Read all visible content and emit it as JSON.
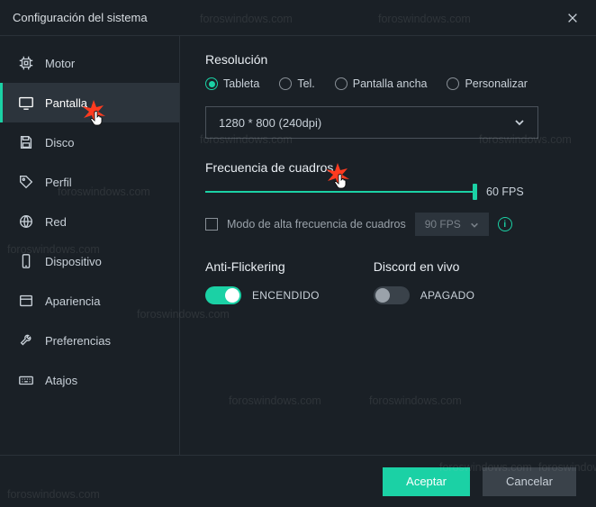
{
  "window": {
    "title": "Configuración del sistema"
  },
  "sidebar": {
    "items": [
      {
        "label": "Motor",
        "icon": "cpu-icon"
      },
      {
        "label": "Pantalla",
        "icon": "display-icon"
      },
      {
        "label": "Disco",
        "icon": "save-icon"
      },
      {
        "label": "Perfil",
        "icon": "tag-icon"
      },
      {
        "label": "Red",
        "icon": "globe-icon"
      },
      {
        "label": "Dispositivo",
        "icon": "phone-icon"
      },
      {
        "label": "Apariencia",
        "icon": "window-icon"
      },
      {
        "label": "Preferencias",
        "icon": "tool-icon"
      },
      {
        "label": "Atajos",
        "icon": "keyboard-icon"
      }
    ],
    "active_index": 1
  },
  "resolution": {
    "title": "Resolución",
    "options": [
      "Tableta",
      "Tel.",
      "Pantalla ancha",
      "Personalizar"
    ],
    "selected_index": 0,
    "dropdown_value": "1280 * 800 (240dpi)"
  },
  "framerate": {
    "title": "Frecuencia de cuadros",
    "value_label": "60 FPS",
    "high_fps_checkbox_label": "Modo de alta frecuencia de cuadros",
    "high_fps_checked": false,
    "high_fps_dropdown": "90 FPS"
  },
  "anti_flicker": {
    "title": "Anti-Flickering",
    "on": true,
    "state_label": "ENCENDIDO"
  },
  "discord": {
    "title": "Discord en vivo",
    "on": false,
    "state_label": "APAGADO"
  },
  "footer": {
    "accept": "Aceptar",
    "cancel": "Cancelar"
  },
  "watermark_text": "foroswindows.com"
}
